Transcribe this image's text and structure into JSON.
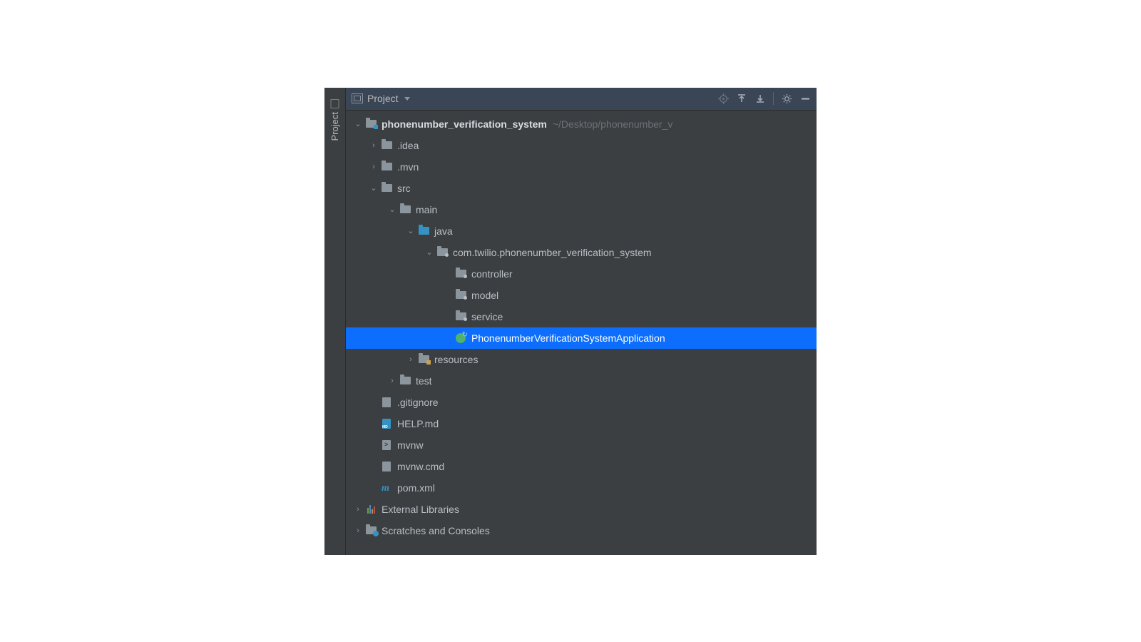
{
  "sidebar": {
    "tab_label": "Project"
  },
  "toolbar": {
    "title": "Project"
  },
  "tree": {
    "root": {
      "name": "phonenumber_verification_system",
      "path": "~/Desktop/phonenumber_v"
    },
    "idea": ".idea",
    "mvn": ".mvn",
    "src": "src",
    "main": "main",
    "java": "java",
    "package": "com.twilio.phonenumber_verification_system",
    "controller": "controller",
    "model": "model",
    "service": "service",
    "app_class": "PhonenumberVerificationSystemApplication",
    "resources": "resources",
    "test": "test",
    "gitignore": ".gitignore",
    "helpmd": "HELP.md",
    "mvnw": "mvnw",
    "mvnwcmd": "mvnw.cmd",
    "pomxml": "pom.xml",
    "ext_lib": "External Libraries",
    "scratches": "Scratches and Consoles"
  }
}
